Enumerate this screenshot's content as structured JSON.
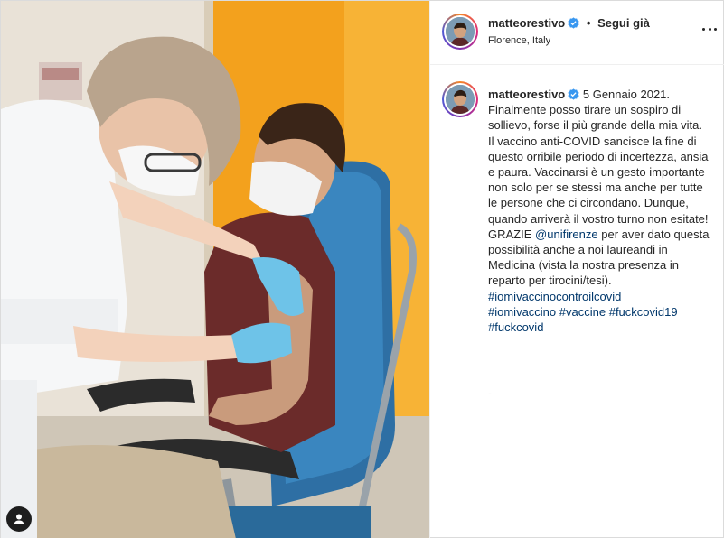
{
  "post": {
    "username": "matteorestivo",
    "follow_label": "Segui già",
    "follow_separator": "•",
    "location": "Florence, Italy",
    "more_icon": "more-options-icon",
    "verified_icon": "verified-badge-icon",
    "user_tag_icon": "user-tag-icon"
  },
  "caption": {
    "username": "matteorestivo",
    "date": "5 Gennaio 2021.",
    "line1": "Finalmente posso tirare un sospiro di sollievo, forse il più grande della mia vita.",
    "line2": "Il vaccino anti-COVID sancisce la fine di questo orribile periodo di incertezza, ansia e paura. Vaccinarsi è un gesto importante non solo per se stessi ma anche per tutte le persone che ci circondano. Dunque, quando arriverà il vostro turno non esitate!",
    "grazie": "GRAZIE",
    "mention": "@unifirenze",
    "after_mention": "per aver dato questa possibilità anche a noi laureandi in Medicina (vista la nostra presenza in reparto per tirocini/tesi).",
    "hashtag1": "#iomivaccinocontroilcovid",
    "hashtag2": "#iomivaccino",
    "hashtag3": "#vaccine",
    "hashtag4": "#fuckcovid19",
    "hashtag5": "#fuckcovid",
    "trailing": "-"
  },
  "colors": {
    "accent_link": "#00376b",
    "verified": "#3897f0",
    "orange_wall": "#f5a51f"
  }
}
